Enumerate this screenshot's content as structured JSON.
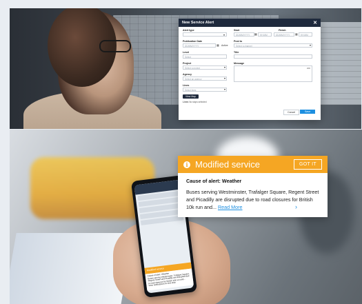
{
  "modal": {
    "title": "New Service Alert",
    "close_glyph": "✕",
    "alert_type_label": "Alert type",
    "start_label": "Start",
    "finish_label": "Finish",
    "start_date_placeholder": "DD/MM/YYYY",
    "start_time_placeholder": "HH:MM",
    "finish_date_placeholder": "DD/MM/YYYY",
    "finish_time_placeholder": "HH:MM",
    "publication_date_label": "Publication Date",
    "publication_date_placeholder": "DD/MM/YYYY",
    "active_label": "Active",
    "post_to_label": "Post to",
    "post_to_placeholder": "Select a channel",
    "level_label": "Level",
    "level_placeholder": "Select",
    "title_label": "Title",
    "project_label": "Project",
    "project_placeholder": "Select a project",
    "message_label": "Message",
    "message_counter": "200",
    "agency_label": "Agency",
    "agency_placeholder": "Select an agency",
    "lines_label": "Lines",
    "lines_placeholder": "Select lines",
    "view_map_label": "View Map",
    "lines_note_label": "Lines",
    "lines_note_value": "No stops selected",
    "cancel_label": "Cancel",
    "save_label": "Save"
  },
  "notification": {
    "title": "Modified service",
    "info_glyph": "i",
    "got_it_label": "GOT IT",
    "cause": "Cause of alert: Weather",
    "description": "Buses serving Westminster, Trafalger Square, Regent Street and Picadilly are disrupted due to road closures for British 10k run and...",
    "read_more_label": "Read More",
    "chevron_glyph": "›"
  },
  "phone": {
    "alert_title": "Modified service",
    "alert_cause": "Cause of alert: Weather",
    "alert_text": "Buses serving Westminster, Trafalger Square, Regent Street and Picadilly are disrupted due to road closures for British 10k run and...",
    "footer": "View notifications for this stop"
  },
  "colors": {
    "accent_orange": "#f5a623",
    "modal_header": "#1f2a3d",
    "link_blue": "#1d8fe0"
  }
}
